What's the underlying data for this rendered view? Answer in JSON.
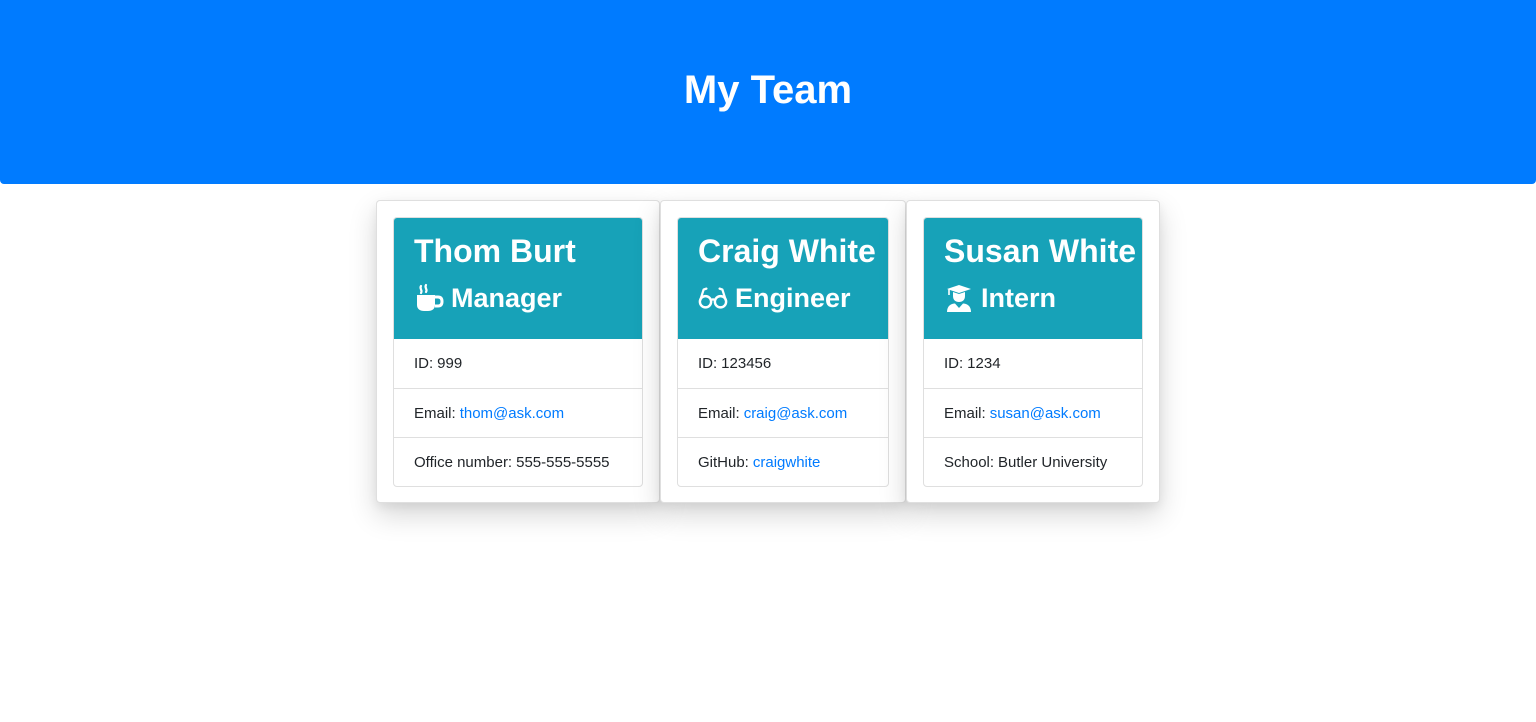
{
  "header": {
    "title": "My Team",
    "background_color": "#007bff"
  },
  "card_header_color": "#17a2b8",
  "link_color": "#007bff",
  "employees": [
    {
      "name": "Thom Burt",
      "role": "Manager",
      "role_icon": "coffee-mug-icon",
      "id_label": "ID:",
      "id": "999",
      "email_label": "Email:",
      "email": "thom@ask.com",
      "extra_label": "Office number:",
      "extra_value": "555-555-5555"
    },
    {
      "name": "Craig White",
      "role": "Engineer",
      "role_icon": "glasses-icon",
      "id_label": "ID:",
      "id": "123456",
      "email_label": "Email:",
      "email": "craig@ask.com",
      "extra_label": "GitHub:",
      "extra_value": "craigwhite"
    },
    {
      "name": "Susan White",
      "role": "Intern",
      "role_icon": "graduate-user-icon",
      "id_label": "ID:",
      "id": "1234",
      "email_label": "Email:",
      "email": "susan@ask.com",
      "extra_label": "School:",
      "extra_value": "Butler University"
    }
  ]
}
